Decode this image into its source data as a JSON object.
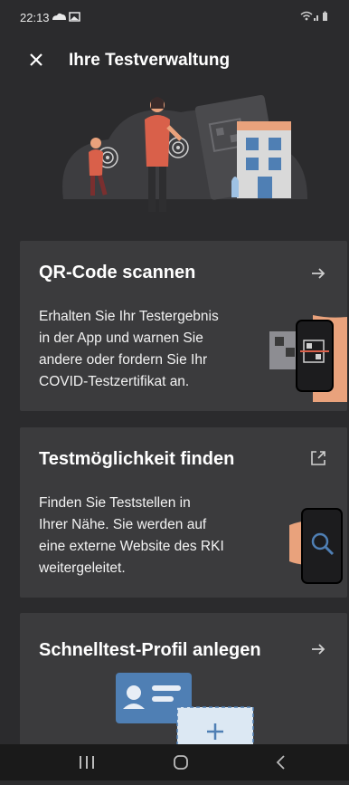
{
  "status": {
    "time": "22:13"
  },
  "header": {
    "title": "Ihre Testverwaltung"
  },
  "cards": [
    {
      "title": "QR-Code scannen",
      "lines": [
        "Erhalten Sie Ihr Testergebnis",
        "in der App und warnen Sie",
        "andere oder fordern Sie Ihr",
        "COVID-Testzertifikat an."
      ],
      "action_icon": "arrow-right-icon"
    },
    {
      "title": "Testmöglichkeit finden",
      "lines": [
        "Finden Sie Teststellen in",
        "Ihrer Nähe. Sie werden auf",
        "eine externe Website des RKI",
        "weitergeleitet."
      ],
      "action_icon": "external-link-icon"
    },
    {
      "title": "Schnelltest-Profil anlegen",
      "lines": [],
      "action_icon": "arrow-right-icon"
    }
  ],
  "colors": {
    "background": "#2b2b2d",
    "card": "#3b3b3d",
    "accent": "#4f7fb4",
    "skin": "#e9a27c",
    "navbar": "#1a1a1a"
  }
}
